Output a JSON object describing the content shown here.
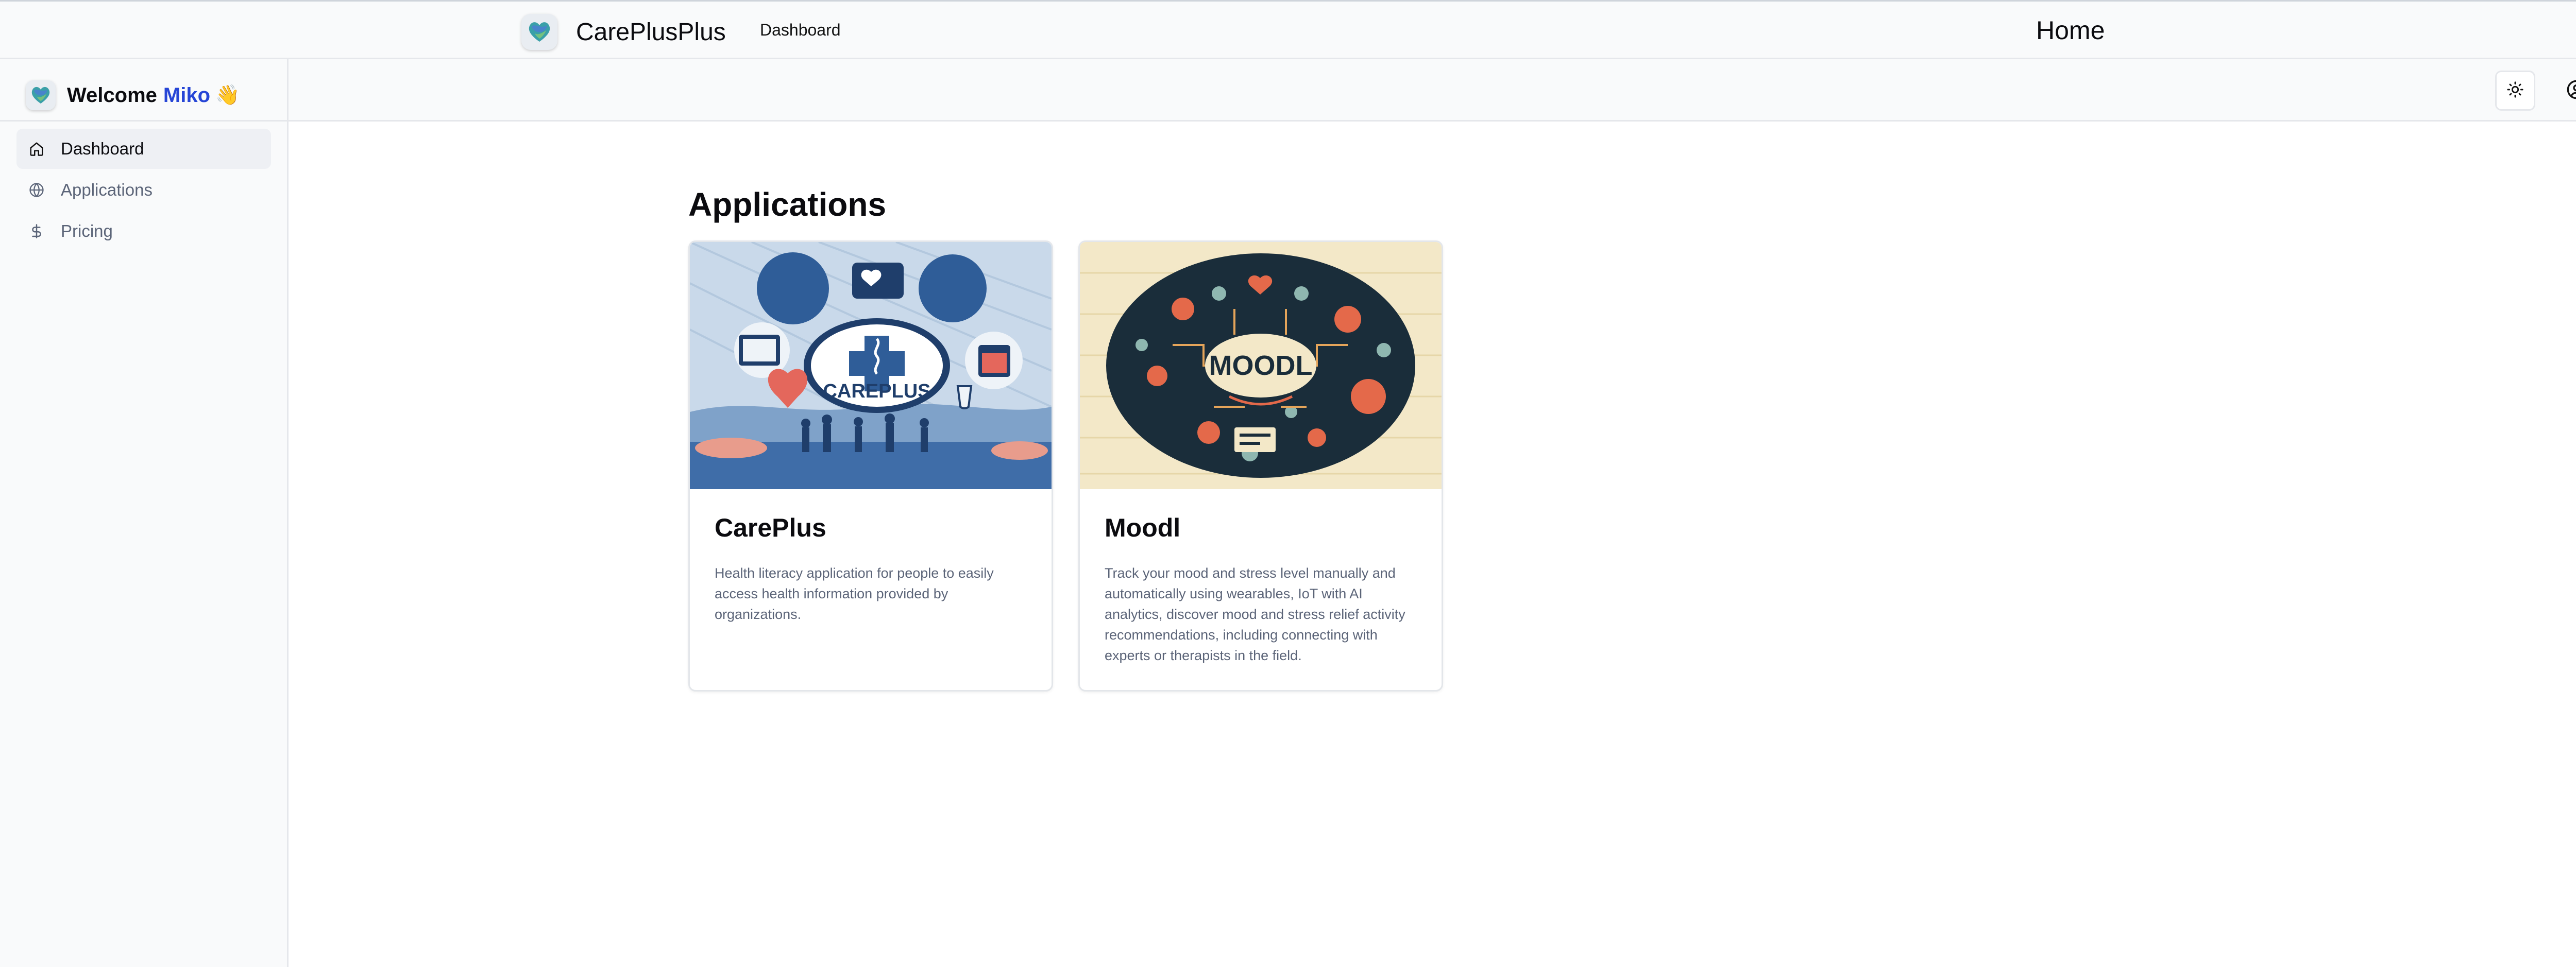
{
  "topbar": {
    "brand": "CarePlusPlus",
    "nav_link": "Dashboard",
    "page_label": "Home"
  },
  "sidebar": {
    "welcome": "Welcome",
    "user_name": "Miko",
    "wave": "👋",
    "items": [
      {
        "label": "Dashboard",
        "icon": "home-icon",
        "active": true
      },
      {
        "label": "Applications",
        "icon": "globe-icon",
        "active": false
      },
      {
        "label": "Pricing",
        "icon": "dollar-icon",
        "active": false
      }
    ]
  },
  "header": {
    "theme_toggle_icon": "sun-icon",
    "account_icon": "user-circle-icon"
  },
  "main": {
    "title": "Applications",
    "cards": [
      {
        "title": "CarePlus",
        "image_text": "CAREPLUS",
        "description": "Health literacy application for people to easily access health information provided by organizations."
      },
      {
        "title": "Moodl",
        "image_text": "MOODL",
        "description": "Track your mood and stress level manually and automatically using wearables, IoT with AI analytics, discover mood and stress relief activity recommendations, including connecting with experts or therapists in the field."
      }
    ]
  },
  "colors": {
    "accent": "#2645d6",
    "muted_text": "#5b6478",
    "sidebar_bg": "#f9fafb",
    "border": "#e5e7eb"
  }
}
